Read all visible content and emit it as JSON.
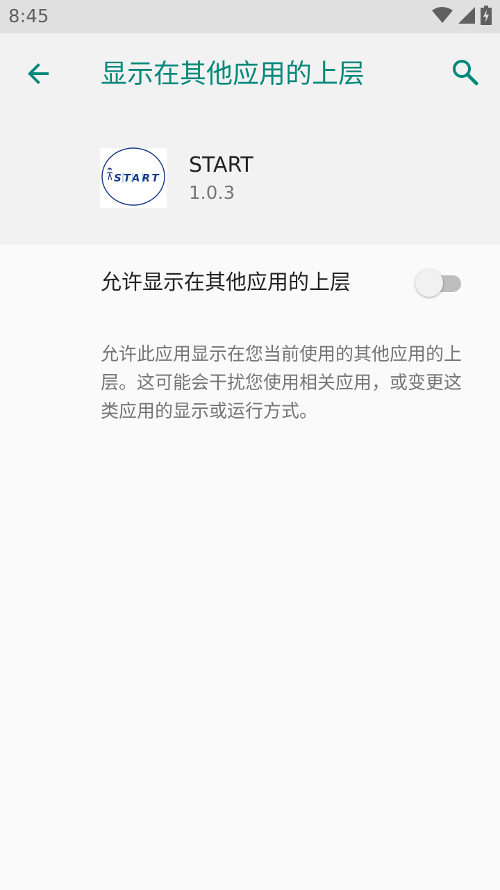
{
  "status_bar": {
    "time": "8:45",
    "icons": [
      "wifi-icon",
      "signal-icon",
      "battery-charging-icon"
    ]
  },
  "toolbar": {
    "back_icon": "arrow-back-icon",
    "title": "显示在其他应用的上层",
    "search_icon": "search-icon",
    "accent_color": "#00897b"
  },
  "app": {
    "name": "START",
    "version": "1.0.3",
    "icon": "start-app-logo"
  },
  "setting": {
    "label": "允许显示在其他应用的上层",
    "enabled": false
  },
  "description": "允许此应用显示在您当前使用的其他应用的上层。这可能会干扰您使用相关应用，或变更这类应用的显示或运行方式。"
}
